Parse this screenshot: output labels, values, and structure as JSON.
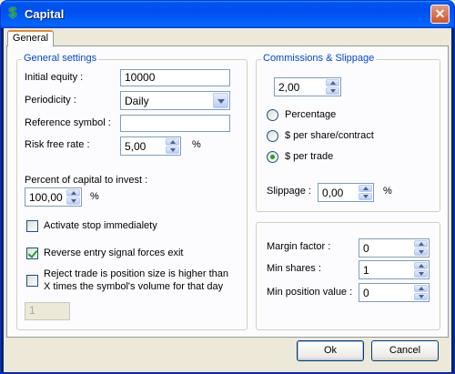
{
  "window": {
    "title": "Capital",
    "icon": "dollar-icon"
  },
  "tabs": [
    {
      "label": "General",
      "selected": true
    }
  ],
  "general_settings": {
    "title": "General settings",
    "initial_equity_label": "Initial equity :",
    "initial_equity_value": "10000",
    "periodicity_label": "Periodicity :",
    "periodicity_value": "Daily",
    "reference_symbol_label": "Reference symbol :",
    "reference_symbol_value": "",
    "risk_free_rate_label": "Risk free rate :",
    "risk_free_rate_value": "5,00",
    "risk_free_rate_unit": "%",
    "percent_capital_label": "Percent of capital to invest :",
    "percent_capital_value": "100,00",
    "percent_capital_unit": "%",
    "activate_stop_label": "Activate stop immedialety",
    "activate_stop_checked": false,
    "reverse_entry_label": "Reverse entry signal forces exit",
    "reverse_entry_checked": true,
    "reject_trade_label_line1": "Reject trade is position size is higher than",
    "reject_trade_label_line2": "X times the symbol's volume for that day",
    "reject_trade_checked": false,
    "reject_trade_value": "1"
  },
  "commissions": {
    "title": "Commissions & Slippage",
    "amount_value": "2,00",
    "options": [
      "Percentage",
      "$ per share/contract",
      "$ per trade"
    ],
    "selected_option": "$ per trade",
    "slippage_label": "Slippage :",
    "slippage_value": "0,00",
    "slippage_unit": "%"
  },
  "margin": {
    "margin_factor_label": "Margin factor :",
    "margin_factor_value": "0",
    "min_shares_label": "Min shares :",
    "min_shares_value": "1",
    "min_position_label": "Min position value :",
    "min_position_value": "0"
  },
  "buttons": {
    "ok": "Ok",
    "cancel": "Cancel"
  }
}
